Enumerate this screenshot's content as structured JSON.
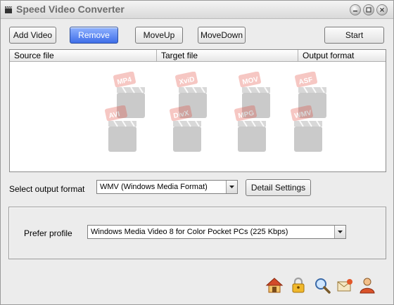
{
  "window": {
    "title": "Speed Video Converter"
  },
  "toolbar": {
    "add_video": "Add Video",
    "remove": "Remove",
    "move_up": "MoveUp",
    "move_down": "MoveDown",
    "start": "Start"
  },
  "file_list": {
    "columns": [
      "Source file",
      "Target file",
      "Output format"
    ],
    "rows": [],
    "watermark_formats": [
      "MP4",
      "XviD",
      "MOV",
      "ASF",
      "AVI",
      "DivX",
      "MPG",
      "WMV"
    ]
  },
  "output_format": {
    "label": "Select output format",
    "value": "WMV (Windows Media Format)",
    "details_button": "Detail Settings"
  },
  "profile": {
    "label": "Prefer profile",
    "value": "Windows Media Video 8 for Color Pocket PCs (225 Kbps)"
  },
  "bottom_icons": [
    "home-icon",
    "lock-icon",
    "search-icon",
    "email-icon",
    "user-icon"
  ],
  "colors": {
    "primary_button": "#3f6ee8",
    "background": "#ececec"
  }
}
